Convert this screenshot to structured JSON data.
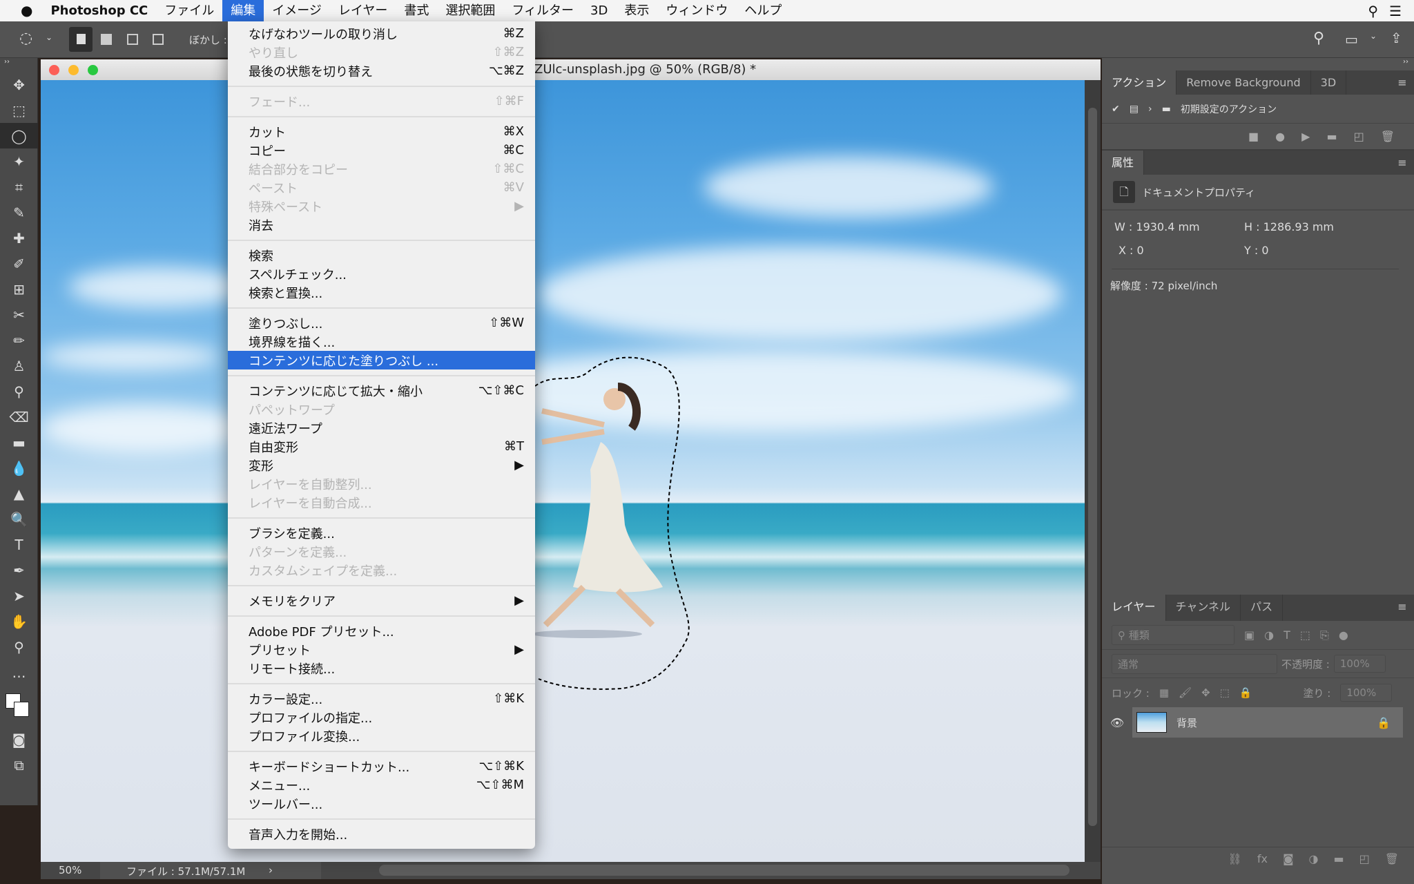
{
  "menubar": {
    "app": "Photoshop CC",
    "items": [
      "ファイル",
      "編集",
      "イメージ",
      "レイヤー",
      "書式",
      "選択範囲",
      "フィルター",
      "3D",
      "表示",
      "ウィンドウ",
      "ヘルプ"
    ],
    "active": "編集"
  },
  "options": {
    "feather_label": "ぼかし :"
  },
  "document": {
    "title": "ZUlc-unsplash.jpg @ 50% (RGB/8) *",
    "zoom": "50%",
    "file_info": "ファイル : 57.1M/57.1M"
  },
  "edit_menu": [
    [
      {
        "label": "なげなわツールの取り消し",
        "shortcut": "⌘Z"
      },
      {
        "label": "やり直し",
        "shortcut": "⇧⌘Z",
        "disabled": true
      },
      {
        "label": "最後の状態を切り替え",
        "shortcut": "⌥⌘Z"
      }
    ],
    [
      {
        "label": "フェード...",
        "shortcut": "⇧⌘F",
        "disabled": true
      }
    ],
    [
      {
        "label": "カット",
        "shortcut": "⌘X"
      },
      {
        "label": "コピー",
        "shortcut": "⌘C"
      },
      {
        "label": "結合部分をコピー",
        "shortcut": "⇧⌘C",
        "disabled": true
      },
      {
        "label": "ペースト",
        "shortcut": "⌘V",
        "disabled": true
      },
      {
        "label": "特殊ペースト",
        "shortcut": "▶",
        "disabled": true
      },
      {
        "label": "消去",
        "shortcut": ""
      }
    ],
    [
      {
        "label": "検索",
        "shortcut": ""
      },
      {
        "label": "スペルチェック...",
        "shortcut": ""
      },
      {
        "label": "検索と置換...",
        "shortcut": ""
      }
    ],
    [
      {
        "label": "塗りつぶし...",
        "shortcut": "⇧⌘W"
      },
      {
        "label": "境界線を描く...",
        "shortcut": ""
      },
      {
        "label": "コンテンツに応じた塗りつぶし ...",
        "shortcut": "",
        "highlighted": true
      }
    ],
    [
      {
        "label": "コンテンツに応じて拡大・縮小",
        "shortcut": "⌥⇧⌘C"
      },
      {
        "label": "パペットワープ",
        "shortcut": "",
        "disabled": true
      },
      {
        "label": "遠近法ワープ",
        "shortcut": ""
      },
      {
        "label": "自由変形",
        "shortcut": "⌘T"
      },
      {
        "label": "変形",
        "shortcut": "▶"
      },
      {
        "label": "レイヤーを自動整列...",
        "shortcut": "",
        "disabled": true
      },
      {
        "label": "レイヤーを自動合成...",
        "shortcut": "",
        "disabled": true
      }
    ],
    [
      {
        "label": "ブラシを定義...",
        "shortcut": ""
      },
      {
        "label": "パターンを定義...",
        "shortcut": "",
        "disabled": true
      },
      {
        "label": "カスタムシェイプを定義...",
        "shortcut": "",
        "disabled": true
      }
    ],
    [
      {
        "label": "メモリをクリア",
        "shortcut": "▶"
      }
    ],
    [
      {
        "label": "Adobe PDF プリセット...",
        "shortcut": ""
      },
      {
        "label": "プリセット",
        "shortcut": "▶"
      },
      {
        "label": "リモート接続...",
        "shortcut": ""
      }
    ],
    [
      {
        "label": "カラー設定...",
        "shortcut": "⇧⌘K"
      },
      {
        "label": "プロファイルの指定...",
        "shortcut": ""
      },
      {
        "label": "プロファイル変換...",
        "shortcut": ""
      }
    ],
    [
      {
        "label": "キーボードショートカット...",
        "shortcut": "⌥⇧⌘K"
      },
      {
        "label": "メニュー...",
        "shortcut": "⌥⇧⌘M"
      },
      {
        "label": "ツールバー...",
        "shortcut": ""
      }
    ],
    [
      {
        "label": "音声入力を開始...",
        "shortcut": ""
      }
    ]
  ],
  "tools": [
    "✥",
    "⬚",
    "◯",
    "✦",
    "⌗",
    "✎",
    "✚",
    "✐",
    "⊞",
    "✂",
    "✏",
    "♙",
    "⚲",
    "⌫",
    "▬",
    "💧",
    "▲",
    "🔍",
    "T",
    "✒",
    "➤",
    "✋",
    "⚲",
    "…"
  ],
  "actions_panel": {
    "tabs": [
      "アクション",
      "Remove Background",
      "3D"
    ],
    "set_name": "初期設定のアクション"
  },
  "properties_panel": {
    "tab": "属性",
    "section": "ドキュメントプロパティ",
    "w": "W : 1930.4 mm",
    "h": "H : 1286.93 mm",
    "x": "X : 0",
    "y": "Y : 0",
    "resolution": "解像度 : 72 pixel/inch"
  },
  "layers_panel": {
    "tabs": [
      "レイヤー",
      "チャンネル",
      "パス"
    ],
    "filter_placeholder": "種類",
    "blend_mode": "通常",
    "opacity_label": "不透明度 :",
    "opacity": "100%",
    "lock_label": "ロック :",
    "fill_label": "塗り :",
    "fill": "100%",
    "layers": [
      {
        "name": "背景",
        "locked": true,
        "visible": true
      }
    ]
  },
  "colors": {
    "accent": "#2a6ddb",
    "panel": "#535353"
  }
}
